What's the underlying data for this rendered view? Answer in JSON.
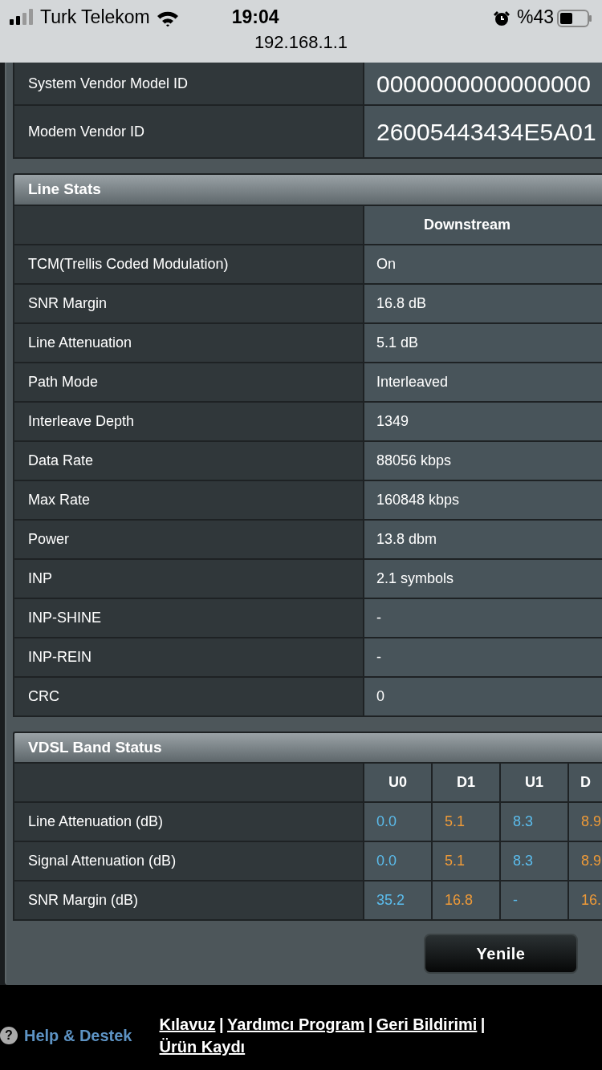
{
  "status_bar": {
    "carrier": "Turk Telekom",
    "time": "19:04",
    "battery": "%43",
    "url": "192.168.1.1"
  },
  "info_rows": [
    {
      "label": "System Vendor Model ID",
      "value": "0000000000000000"
    },
    {
      "label": "Modem Vendor ID",
      "value": "26005443434E5A01"
    }
  ],
  "line_stats": {
    "title": "Line Stats",
    "column": "Downstream",
    "rows": [
      {
        "label": "TCM(Trellis Coded Modulation)",
        "value": "On"
      },
      {
        "label": "SNR Margin",
        "value": "16.8 dB"
      },
      {
        "label": "Line Attenuation",
        "value": "5.1 dB"
      },
      {
        "label": "Path Mode",
        "value": "Interleaved"
      },
      {
        "label": "Interleave Depth",
        "value": "1349"
      },
      {
        "label": "Data Rate",
        "value": "88056 kbps"
      },
      {
        "label": "Max Rate",
        "value": "160848 kbps"
      },
      {
        "label": "Power",
        "value": "13.8 dbm"
      },
      {
        "label": "INP",
        "value": "2.1 symbols"
      },
      {
        "label": "INP-SHINE",
        "value": "-"
      },
      {
        "label": "INP-REIN",
        "value": "-"
      },
      {
        "label": "CRC",
        "value": "0"
      }
    ]
  },
  "band_status": {
    "title": "VDSL Band Status",
    "columns": [
      {
        "label": "U0",
        "color": "#5bbcec"
      },
      {
        "label": "D1",
        "color": "#ee9a38"
      },
      {
        "label": "U1",
        "color": "#5bbcec"
      },
      {
        "label": "D",
        "color": "#ee9a38"
      }
    ],
    "rows": [
      {
        "label": "Line Attenuation (dB)",
        "values": [
          "0.0",
          "5.1",
          "8.3",
          "8.9"
        ]
      },
      {
        "label": "Signal Attenuation (dB)",
        "values": [
          "0.0",
          "5.1",
          "8.3",
          "8.9"
        ]
      },
      {
        "label": "SNR Margin (dB)",
        "values": [
          "35.2",
          "16.8",
          "-",
          "16."
        ]
      }
    ]
  },
  "refresh_button": "Yenile",
  "footer": {
    "help_icon": "?",
    "help": "Help & Destek",
    "items": [
      {
        "kind": "link",
        "text": "Kılavuz"
      },
      {
        "kind": "separator",
        "text": "|"
      },
      {
        "kind": "link",
        "text": "Yardımcı Program"
      },
      {
        "kind": "separator",
        "text": "|"
      },
      {
        "kind": "link",
        "text": "Geri Bildirimi"
      },
      {
        "kind": "separator",
        "text": "|"
      },
      {
        "kind": "link",
        "text": "Ürün Kaydı"
      }
    ]
  }
}
